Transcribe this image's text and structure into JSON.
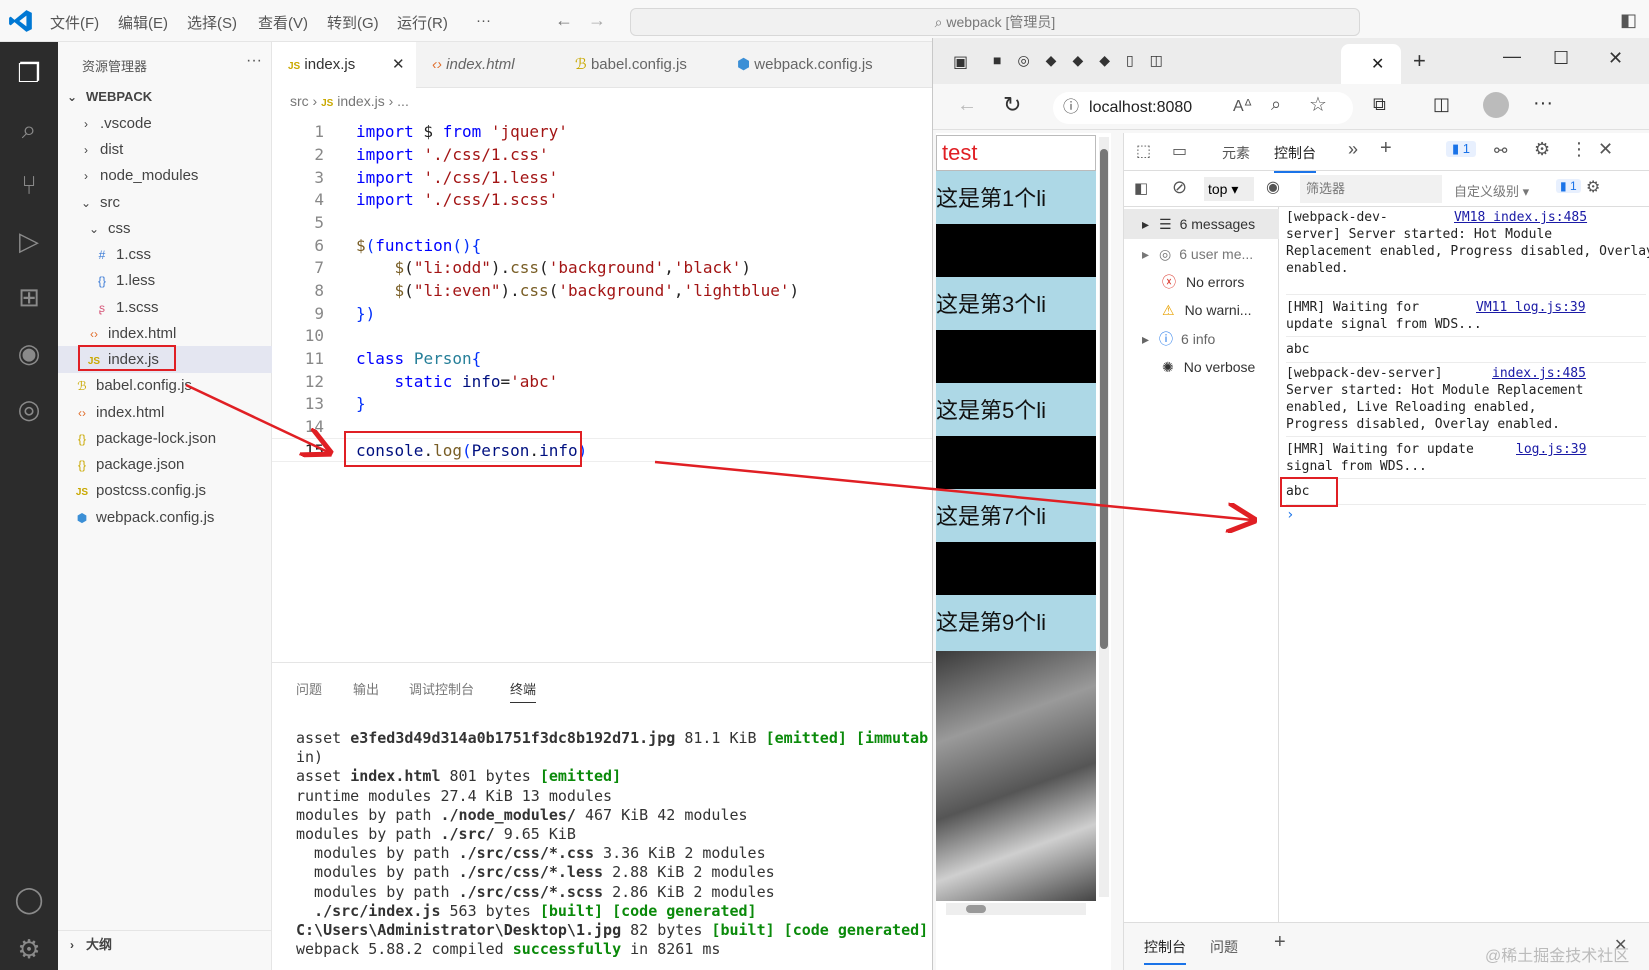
{
  "titlebar": {
    "menus": [
      "文件(F)",
      "编辑(E)",
      "选择(S)",
      "查看(V)",
      "转到(G)",
      "运行(R)"
    ],
    "more": "···",
    "search": "webpack [管理员]"
  },
  "explorer": {
    "title": "资源管理器",
    "more": "···",
    "root": "WEBPACK",
    "items": [
      ".vscode",
      "dist",
      "node_modules",
      "src",
      "css",
      "1.css",
      "1.less",
      "1.scss",
      "index.html",
      "index.js",
      "babel.config.js",
      "index.html",
      "package-lock.json",
      "package.json",
      "postcss.config.js",
      "webpack.config.js"
    ],
    "outline": "大纲"
  },
  "editor": {
    "tabs": [
      "index.js",
      "index.html",
      "babel.config.js",
      "webpack.config.js"
    ],
    "breadcrumb": [
      "src",
      "index.js",
      "..."
    ],
    "line_numbers": [
      "1",
      "2",
      "3",
      "4",
      "5",
      "6",
      "7",
      "8",
      "9",
      "10",
      "11",
      "12",
      "13",
      "14",
      "15"
    ]
  },
  "panel": {
    "tabs": [
      "问题",
      "输出",
      "调试控制台",
      "终端"
    ],
    "terminal": [
      "asset e3fed3d49d314a0b1751f3dc8b192d71.jpg 81.1 KiB [emitted] [immutab",
      "in)",
      "asset index.html 801 bytes [emitted]",
      "runtime modules 27.4 KiB 13 modules",
      "modules by path ./node_modules/ 467 KiB 42 modules",
      "modules by path ./src/ 9.65 KiB",
      "  modules by path ./src/css/*.css 3.36 KiB 2 modules",
      "  modules by path ./src/css/*.less 2.88 KiB 2 modules",
      "  modules by path ./src/css/*.scss 2.86 KiB 2 modules",
      "  ./src/index.js 563 bytes [built] [code generated]",
      "C:\\Users\\Administrator\\Desktop\\1.jpg 82 bytes [built] [code generated]",
      "webpack 5.88.2 compiled successfully in 8261 ms"
    ]
  },
  "browser": {
    "url": "localhost:8080",
    "page_title": "test",
    "list_items": [
      "这是第1个li",
      "这是第3个li",
      "这是第5个li",
      "这是第7个li",
      "这是第9个li"
    ]
  },
  "devtools": {
    "tabs": [
      "元素",
      "控制台"
    ],
    "badge": "1",
    "context": "top",
    "filter_placeholder": "筛选器",
    "level": "自定义级别",
    "sidebar": [
      "6 messages",
      "6 user me...",
      "No errors",
      "No warni...",
      "6 info",
      "No verbose"
    ],
    "logs": [
      {
        "text": "[webpack-dev-\nserver] Server started: Hot Module\nReplacement enabled, Progress disabled, Overlay\nenabled.",
        "src": "VM18 index.js:485"
      },
      {
        "text": "[HMR] Waiting for\nupdate signal from WDS...",
        "src": "VM11 log.js:39"
      },
      {
        "text": "abc",
        "src": ""
      },
      {
        "text": "[webpack-dev-server]\nServer started: Hot Module Replacement\nenabled, Live Reloading enabled,\nProgress disabled, Overlay enabled.",
        "src": "index.js:485"
      },
      {
        "text": "[HMR] Waiting for update\nsignal from WDS...",
        "src": "log.js:39"
      },
      {
        "text": "abc",
        "src": ""
      }
    ],
    "drawer_tabs": [
      "控制台",
      "问题"
    ]
  },
  "watermark": "@稀土掘金技术社区"
}
